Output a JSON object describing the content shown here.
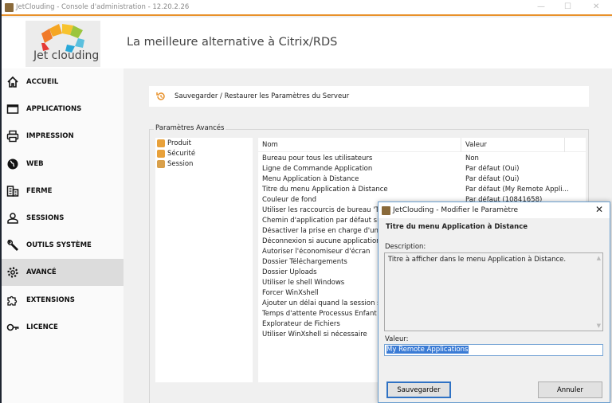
{
  "window": {
    "title": "JetClouding - Console d'administration - 12.20.2.26"
  },
  "header": {
    "logo_text": "Jet clouding",
    "tagline": "La meilleure alternative à Citrix/RDS"
  },
  "sidebar": {
    "items": [
      {
        "label": "ACCUEIL",
        "icon": "home-icon"
      },
      {
        "label": "APPLICATIONS",
        "icon": "window-icon"
      },
      {
        "label": "IMPRESSION",
        "icon": "printer-icon"
      },
      {
        "label": "WEB",
        "icon": "globe-icon"
      },
      {
        "label": "FERME",
        "icon": "building-icon"
      },
      {
        "label": "SESSIONS",
        "icon": "user-icon"
      },
      {
        "label": "OUTILS SYSTÈME",
        "icon": "wrench-icon"
      },
      {
        "label": "AVANCÉ",
        "icon": "gear-icon",
        "active": true
      },
      {
        "label": "EXTENSIONS",
        "icon": "puzzle-icon"
      },
      {
        "label": "LICENCE",
        "icon": "key-icon"
      }
    ]
  },
  "main": {
    "save_restore": "Sauvegarder / Restaurer les Paramètres du Serveur",
    "group_label": "Paramètres Avancés",
    "tree": [
      {
        "label": "Produit",
        "color": "#e8a13a"
      },
      {
        "label": "Sécurité",
        "color": "#e8a13a"
      },
      {
        "label": "Session",
        "color": "#d9a04a"
      }
    ],
    "columns": {
      "name": "Nom",
      "value": "Valeur"
    },
    "rows": [
      {
        "name": "Bureau pour tous les utilisateurs",
        "value": "Non"
      },
      {
        "name": "Ligne de Commande Application",
        "value": "Par défaut (Oui)"
      },
      {
        "name": "Menu Application à Distance",
        "value": "Par défaut (Oui)"
      },
      {
        "name": "Titre du menu Application à Distance",
        "value": "Par défaut (My Remote Appli..."
      },
      {
        "name": "Couleur de fond",
        "value": "Par défaut (10841658)"
      },
      {
        "name": "Utiliser les raccourcis de bureau 'Tous",
        "value": ""
      },
      {
        "name": "Chemin d'application par défaut si au",
        "value": ""
      },
      {
        "name": "Désactiver la prise en charge d'un Pro",
        "value": ""
      },
      {
        "name": "Déconnexion si aucune application",
        "value": ""
      },
      {
        "name": "Autoriser l'économiseur d'écran",
        "value": ""
      },
      {
        "name": "Dossier Téléchargements",
        "value": ""
      },
      {
        "name": "Dossier Uploads",
        "value": ""
      },
      {
        "name": "Utiliser le shell Windows",
        "value": ""
      },
      {
        "name": "Forcer WinXshell",
        "value": ""
      },
      {
        "name": "Ajouter un délai quand la session s'o",
        "value": ""
      },
      {
        "name": "Temps d'attente Processus Enfant",
        "value": ""
      },
      {
        "name": "Explorateur de Fichiers",
        "value": ""
      },
      {
        "name": "Utiliser WinXshell si nécessaire",
        "value": ""
      }
    ]
  },
  "dialog": {
    "title": "JetClouding - Modifier le Paramètre",
    "heading": "Titre du menu Application à Distance",
    "description_label": "Description:",
    "description": "Titre à afficher dans le menu Application à Distance.",
    "value_label": "Valeur:",
    "value": "My Remote Applications",
    "save": "Sauvegarder",
    "cancel": "Annuler"
  },
  "colors": {
    "accent": "#e8912a",
    "selection": "#3a7bd5",
    "dialog_border": "#6b9fcf"
  }
}
